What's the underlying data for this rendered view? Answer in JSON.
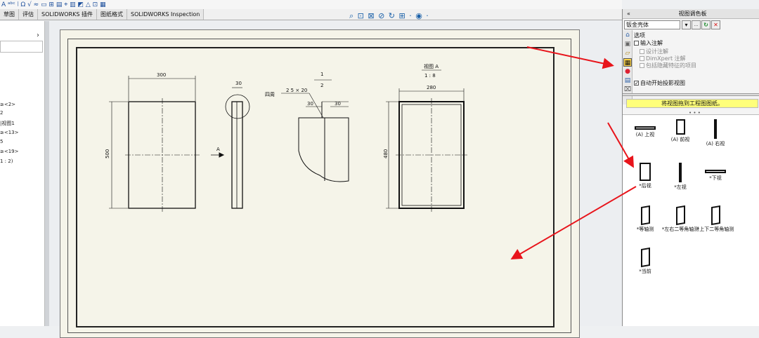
{
  "toolbar": {
    "left_glyphs": "A ᵃᵇᶜ ⦚ Ω √ ≈ ▭ ⊞ ▤ ⌖ ▥ ◩ △ ⊡ ▦"
  },
  "tabs": [
    "草图",
    "评估",
    "SOLIDWORKS 插件",
    "图纸格式",
    "SOLIDWORKS Inspection"
  ],
  "sidebar": {
    "items": [
      "≥<2>",
      "2",
      "|视图1",
      "≥<13>",
      "5",
      "≥<19>",
      "1 : 2)"
    ]
  },
  "view_tools": "⌕ ⊡ ⊠ ⊘ ↻ ⊞ · ◉ ·",
  "drawing": {
    "front": {
      "width": "300",
      "height": "500"
    },
    "side": {
      "dim": "30",
      "label_a": "A"
    },
    "detail": {
      "scale_num": "1",
      "scale_den": "2",
      "fold_label": "四周",
      "spec": "2 5 × 20",
      "dim_left": "30",
      "dim_right": "30"
    },
    "section": {
      "title": "视图 A",
      "scale": "1 : 8",
      "width": "280",
      "height": "480"
    }
  },
  "palette": {
    "title": "视图调色板",
    "collapse": "«",
    "select_value": "钣金壳体",
    "btn_dots": "...",
    "btn_refresh": "↻",
    "btn_close": "✕",
    "options_label": "选项",
    "opt_input_annotations": "输入注解",
    "opt_design_annotations": "设计注解",
    "opt_dimxpert": "DimXpert 注解",
    "opt_hidden_features": "包括隐藏特征的项目",
    "opt_auto_projection": "自动开始投影视图",
    "drag_message": "将视图拖到工程图图纸。",
    "grip": "• • •"
  },
  "views": [
    {
      "label": "(A) 上视",
      "shape": "flat"
    },
    {
      "label": "(A) 前视",
      "shape": "tall"
    },
    {
      "label": "(A) 右视",
      "shape": "bar"
    },
    {
      "label": "*后视",
      "shape": "tall"
    },
    {
      "label": "*左视",
      "shape": "bar"
    },
    {
      "label": "*下视",
      "shape": "flat"
    },
    {
      "label": "*等轴测",
      "shape": "iso"
    },
    {
      "label": "*左右二等角轴测",
      "shape": "iso"
    },
    {
      "label": "*上下二等角轴测",
      "shape": "iso"
    },
    {
      "label": "*当前",
      "shape": "iso"
    }
  ],
  "colors": {
    "annotation_arrow": "#e8141b",
    "sheet_background": "#f5f4e9",
    "drag_message_bg": "#ffff7a"
  }
}
